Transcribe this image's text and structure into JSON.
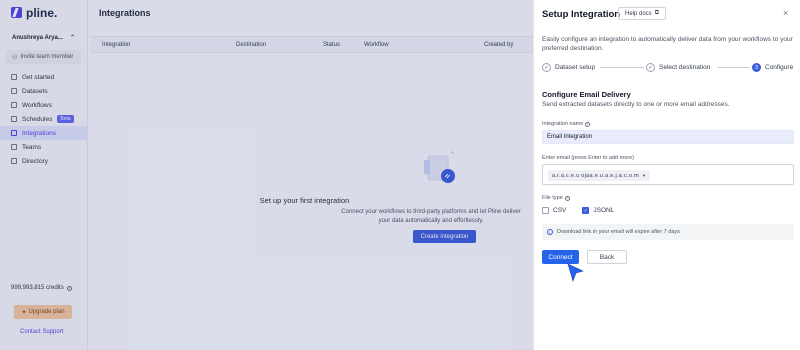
{
  "app": {
    "logo": "pline.",
    "workspace": "Anushreya Arya...",
    "invite": "Invite team member",
    "nav": [
      {
        "label": "Get started",
        "active": false
      },
      {
        "label": "Datasets",
        "active": false
      },
      {
        "label": "Workflows",
        "active": false
      },
      {
        "label": "Schedules",
        "active": false,
        "badge": "Beta"
      },
      {
        "label": "Integrations",
        "active": true
      },
      {
        "label": "Teams",
        "active": false
      },
      {
        "label": "Directory",
        "active": false
      }
    ],
    "credits": "999,993,815 credits",
    "upgrade": "Upgrade plan",
    "support": "Contact Support"
  },
  "main": {
    "title": "Integrations",
    "columns": [
      "Integration",
      "Destination",
      "Status",
      "Workflow",
      "Created by"
    ],
    "empty_title": "Set up your first integration",
    "empty_text": "Connect your workflows to third-party platforms and let Pline deliver your data automatically and effortlessly.",
    "create_button": "Create integration"
  },
  "panel": {
    "title": "Setup Integration",
    "help_button": "Help docs",
    "close": "×",
    "description": "Easily configure an integration to automatically deliver data from your workflows to your preferred destination.",
    "steps": [
      {
        "label": "Dataset setup",
        "state": "done"
      },
      {
        "label": "Select destination",
        "state": "done"
      },
      {
        "label": "Configure",
        "state": "current",
        "number": "3"
      }
    ],
    "section_title": "Configure Email Delivery",
    "section_subtitle": "Send extracted datasets directly to one or more email addresses.",
    "name_label": "Integration name",
    "name_value": "Email Integration",
    "email_label": "Enter email (press Enter to add more)",
    "email_chip": "a.r.a.c.e.u ojaa.e.u.a.e.j.a.c.o.m",
    "file_type_label": "File type",
    "options": [
      {
        "label": "CSV",
        "checked": false
      },
      {
        "label": "JSONL",
        "checked": true
      }
    ],
    "note": "Download link in your email will expire after 7 days",
    "connect_button": "Connect",
    "back_button": "Back"
  },
  "colors": {
    "accent": "#3b5bdb",
    "primary_button": "#2563eb",
    "active_nav": "#4f46e5"
  }
}
